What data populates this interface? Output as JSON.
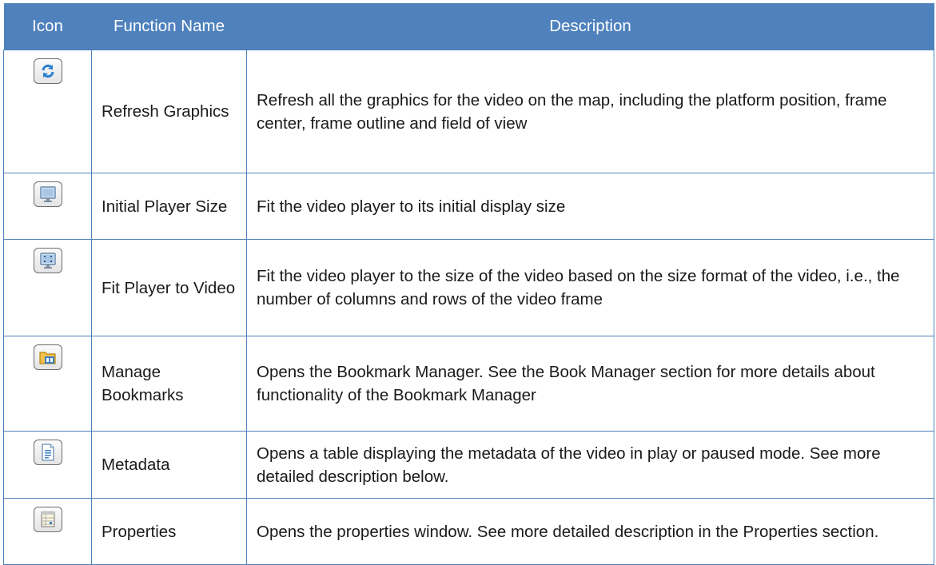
{
  "table": {
    "headers": {
      "icon": "Icon",
      "function_name": "Function Name",
      "description": "Description"
    },
    "rows": [
      {
        "icon": "refresh-icon",
        "name": "Refresh Graphics",
        "description": "Refresh all the graphics for the video on the map, including the platform position, frame center, frame outline and field of view"
      },
      {
        "icon": "monitor-icon",
        "name": "Initial Player Size",
        "description": "Fit the video player to its initial display size"
      },
      {
        "icon": "fit-screen-icon",
        "name": "Fit Player to Video",
        "description": "Fit the video player to the size of the video based on the size format of the video, i.e., the number of columns and rows of the video frame"
      },
      {
        "icon": "bookmark-folder-icon",
        "name": "Manage Bookmarks",
        "description": "Opens the Bookmark Manager. See the Book Manager section for more details about functionality of the Bookmark Manager"
      },
      {
        "icon": "document-icon",
        "name": "Metadata",
        "description": "Opens a table displaying the metadata of the video in play or paused mode. See more detailed description below."
      },
      {
        "icon": "properties-grid-icon",
        "name": "Properties",
        "description": "Opens the properties window. See more detailed description in the Properties section."
      }
    ]
  },
  "colors": {
    "header_background": "#4f81bd",
    "header_text": "#ffffff",
    "border": "#4f81bd"
  }
}
